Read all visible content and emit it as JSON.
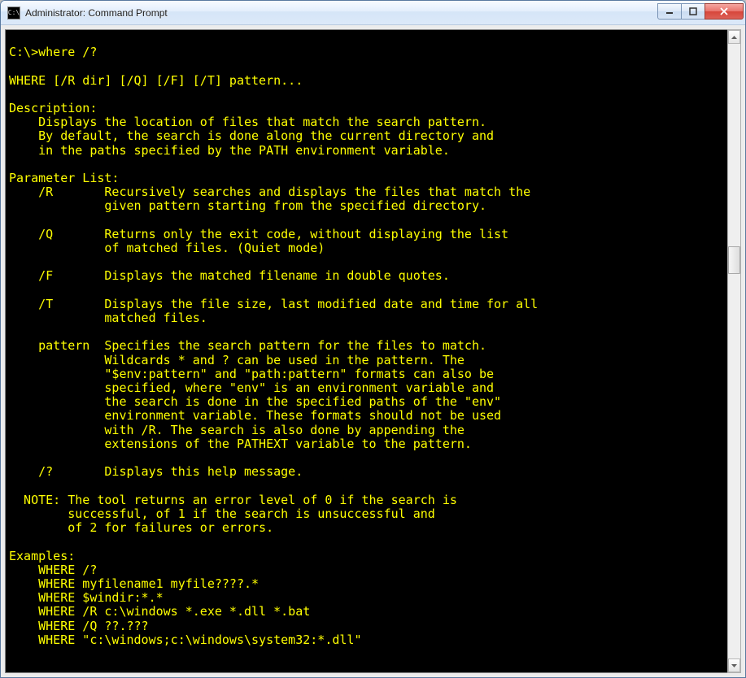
{
  "window": {
    "title": "Administrator: Command Prompt"
  },
  "terminal": {
    "prompt_line": "C:\\>where /?",
    "blank": "",
    "usage": "WHERE [/R dir] [/Q] [/F] [/T] pattern...",
    "desc_head": "Description:",
    "desc_l1": "    Displays the location of files that match the search pattern.",
    "desc_l2": "    By default, the search is done along the current directory and",
    "desc_l3": "    in the paths specified by the PATH environment variable.",
    "plist_head": "Parameter List:",
    "r_l1": "    /R       Recursively searches and displays the files that match the",
    "r_l2": "             given pattern starting from the specified directory.",
    "q_l1": "    /Q       Returns only the exit code, without displaying the list",
    "q_l2": "             of matched files. (Quiet mode)",
    "f_l1": "    /F       Displays the matched filename in double quotes.",
    "t_l1": "    /T       Displays the file size, last modified date and time for all",
    "t_l2": "             matched files.",
    "p_l1": "    pattern  Specifies the search pattern for the files to match.",
    "p_l2": "             Wildcards * and ? can be used in the pattern. The",
    "p_l3": "             \"$env:pattern\" and \"path:pattern\" formats can also be",
    "p_l4": "             specified, where \"env\" is an environment variable and",
    "p_l5": "             the search is done in the specified paths of the \"env\"",
    "p_l6": "             environment variable. These formats should not be used",
    "p_l7": "             with /R. The search is also done by appending the",
    "p_l8": "             extensions of the PATHEXT variable to the pattern.",
    "h_l1": "    /?       Displays this help message.",
    "note_l1": "  NOTE: The tool returns an error level of 0 if the search is",
    "note_l2": "        successful, of 1 if the search is unsuccessful and",
    "note_l3": "        of 2 for failures or errors.",
    "ex_head": "Examples:",
    "ex_1": "    WHERE /?",
    "ex_2": "    WHERE myfilename1 myfile????.*",
    "ex_3": "    WHERE $windir:*.*",
    "ex_4": "    WHERE /R c:\\windows *.exe *.dll *.bat",
    "ex_5": "    WHERE /Q ??.???",
    "ex_6": "    WHERE \"c:\\windows;c:\\windows\\system32:*.dll\""
  }
}
